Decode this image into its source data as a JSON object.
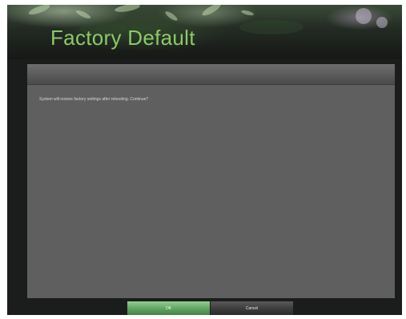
{
  "dialog": {
    "title": "Factory Default",
    "message": "System will restore factory settings after rebooting. Continue?"
  },
  "buttons": {
    "ok_label": "OK",
    "cancel_label": "Cancel"
  },
  "colors": {
    "title_green": "#8cc96a",
    "panel_gray": "#5f5f5f",
    "frame_dark": "#1b1c1c",
    "ok_green": "#5f9f5f",
    "cancel_dark": "#3a3a3a"
  },
  "icons": {
    "header_decoration": "leaf-banner-image"
  }
}
